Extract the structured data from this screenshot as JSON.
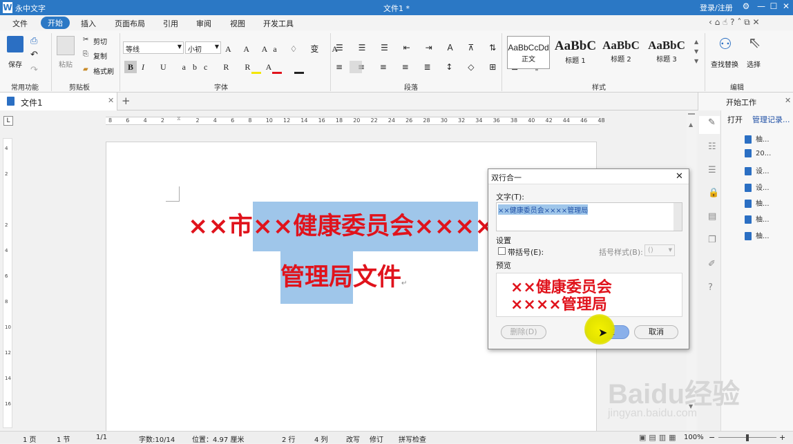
{
  "titlebar": {
    "app": "永中文字",
    "doc_title": "文件1 *",
    "login": "登录/注册",
    "logo": "W"
  },
  "menu": [
    "文件",
    "开始",
    "插入",
    "页面布局",
    "引用",
    "审阅",
    "视图",
    "开发工具"
  ],
  "ribbon": {
    "save": "保存",
    "paste": "粘贴",
    "cut": "剪切",
    "copy": "复制",
    "format_painter": "格式刷",
    "group_common": "常用功能",
    "group_clipboard": "剪贴板",
    "font_name": "等线",
    "font_size": "小初",
    "group_font": "字体",
    "group_paragraph": "段落",
    "styles": [
      {
        "preview": "AaBbCcDd",
        "name": "正文"
      },
      {
        "preview": "AaBbC",
        "name": "标题 1"
      },
      {
        "preview": "AaBbC",
        "name": "标题 2"
      },
      {
        "preview": "AaBbC",
        "name": "标题 3"
      }
    ],
    "group_styles": "样式",
    "find_replace": "查找替换",
    "select": "选择",
    "group_edit": "编辑"
  },
  "tab": {
    "name": "文件1"
  },
  "ruler_ticks": [
    "8",
    "6",
    "4",
    "2",
    "",
    "2",
    "4",
    "6",
    "8",
    "10",
    "12",
    "14",
    "16",
    "18",
    "20",
    "22",
    "24",
    "26",
    "28",
    "30",
    "32",
    "34",
    "36",
    "38",
    "40",
    "42",
    "44",
    "46",
    "48"
  ],
  "vruler_ticks": [
    "4",
    "2",
    "",
    "2",
    "4",
    "6",
    "8",
    "10",
    "12",
    "14",
    "16"
  ],
  "document": {
    "line1_prefix": "××市",
    "line1_selected": "××健康委员会××××",
    "line2_selected": "管理局",
    "line2_suffix": "文件"
  },
  "dialog": {
    "title": "双行合一",
    "text_label": "文字(T):",
    "text_value": "××健康委员会××××管理局",
    "settings_label": "设置",
    "bracket_checkbox": "带括号(E):",
    "bracket_style_label": "括号样式(B):",
    "bracket_style_value": "()",
    "preview_label": "预览",
    "preview_line1": "××健康委员会",
    "preview_line2": "××××管理局",
    "delete_button": "删除(D)",
    "ok_button": "确定",
    "cancel_button": "取消"
  },
  "right_panel": {
    "title": "开始工作",
    "open": "打开",
    "manage": "管理记录...",
    "recent": [
      "柚...",
      "20...",
      "设...",
      "设...",
      "柚...",
      "柚...",
      "柚..."
    ]
  },
  "status": {
    "page": "1 页",
    "section": "1 节",
    "page_of": "1/1",
    "word_count": "字数:10/14",
    "position": "位置：4.97 厘米",
    "row": "2 行",
    "col": "4 列",
    "overwrite": "改写",
    "revise": "修订",
    "spell": "拼写检查",
    "zoom": "100%"
  },
  "watermark": {
    "text": "Baidu经验",
    "url": "jingyan.baidu.com"
  }
}
